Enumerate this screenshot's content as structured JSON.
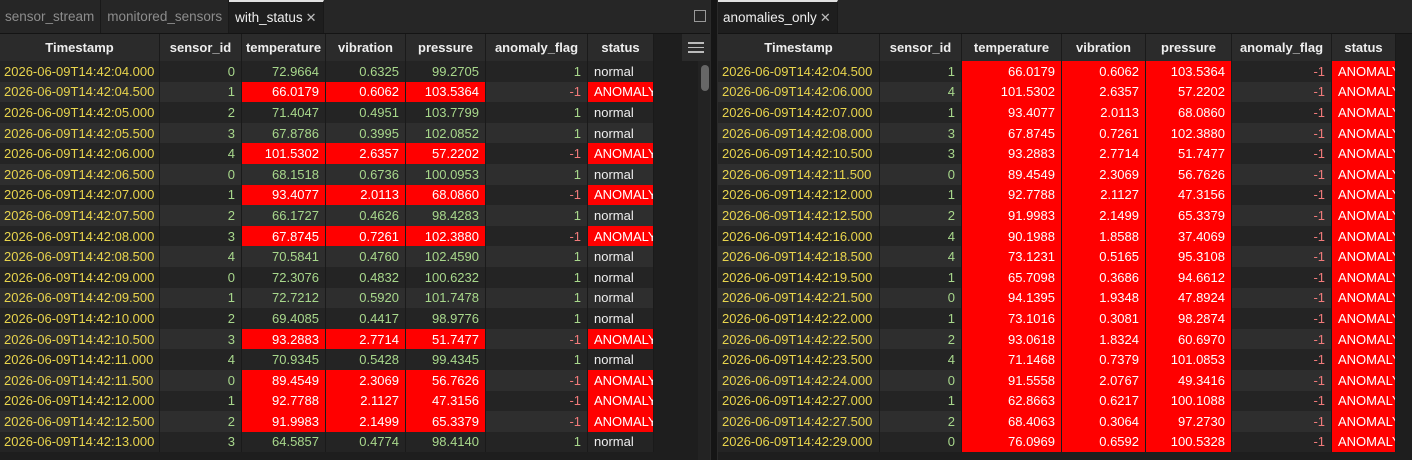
{
  "left": {
    "tabs": [
      {
        "label": "sensor_stream",
        "active": false,
        "closable": false
      },
      {
        "label": "monitored_sensors",
        "active": false,
        "closable": false
      },
      {
        "label": "with_status",
        "active": true,
        "closable": true
      }
    ],
    "columns": [
      "Timestamp",
      "sensor_id",
      "temperature",
      "vibration",
      "pressure",
      "anomaly_flag",
      "status"
    ],
    "rows": [
      [
        "2026-06-09T14:42:04.000",
        "0",
        "72.9664",
        "0.6325",
        "99.2705",
        "1",
        "normal"
      ],
      [
        "2026-06-09T14:42:04.500",
        "1",
        "66.0179",
        "0.6062",
        "103.5364",
        "-1",
        "ANOMALY"
      ],
      [
        "2026-06-09T14:42:05.000",
        "2",
        "71.4047",
        "0.4951",
        "103.7799",
        "1",
        "normal"
      ],
      [
        "2026-06-09T14:42:05.500",
        "3",
        "67.8786",
        "0.3995",
        "102.0852",
        "1",
        "normal"
      ],
      [
        "2026-06-09T14:42:06.000",
        "4",
        "101.5302",
        "2.6357",
        "57.2202",
        "-1",
        "ANOMALY"
      ],
      [
        "2026-06-09T14:42:06.500",
        "0",
        "68.1518",
        "0.6736",
        "100.0953",
        "1",
        "normal"
      ],
      [
        "2026-06-09T14:42:07.000",
        "1",
        "93.4077",
        "2.0113",
        "68.0860",
        "-1",
        "ANOMALY"
      ],
      [
        "2026-06-09T14:42:07.500",
        "2",
        "66.1727",
        "0.4626",
        "98.4283",
        "1",
        "normal"
      ],
      [
        "2026-06-09T14:42:08.000",
        "3",
        "67.8745",
        "0.7261",
        "102.3880",
        "-1",
        "ANOMALY"
      ],
      [
        "2026-06-09T14:42:08.500",
        "4",
        "70.5841",
        "0.4760",
        "102.4590",
        "1",
        "normal"
      ],
      [
        "2026-06-09T14:42:09.000",
        "0",
        "72.3076",
        "0.4832",
        "100.6232",
        "1",
        "normal"
      ],
      [
        "2026-06-09T14:42:09.500",
        "1",
        "72.7212",
        "0.5920",
        "101.7478",
        "1",
        "normal"
      ],
      [
        "2026-06-09T14:42:10.000",
        "2",
        "69.4085",
        "0.4417",
        "98.9776",
        "1",
        "normal"
      ],
      [
        "2026-06-09T14:42:10.500",
        "3",
        "93.2883",
        "2.7714",
        "51.7477",
        "-1",
        "ANOMALY"
      ],
      [
        "2026-06-09T14:42:11.000",
        "4",
        "70.9345",
        "0.5428",
        "99.4345",
        "1",
        "normal"
      ],
      [
        "2026-06-09T14:42:11.500",
        "0",
        "89.4549",
        "2.3069",
        "56.7626",
        "-1",
        "ANOMALY"
      ],
      [
        "2026-06-09T14:42:12.000",
        "1",
        "92.7788",
        "2.1127",
        "47.3156",
        "-1",
        "ANOMALY"
      ],
      [
        "2026-06-09T14:42:12.500",
        "2",
        "91.9983",
        "2.1499",
        "65.3379",
        "-1",
        "ANOMALY"
      ],
      [
        "2026-06-09T14:42:13.000",
        "3",
        "64.5857",
        "0.4774",
        "98.4140",
        "1",
        "normal"
      ]
    ]
  },
  "right": {
    "tabs": [
      {
        "label": "anomalies_only",
        "active": true,
        "closable": true
      }
    ],
    "columns": [
      "Timestamp",
      "sensor_id",
      "temperature",
      "vibration",
      "pressure",
      "anomaly_flag",
      "status"
    ],
    "rows": [
      [
        "2026-06-09T14:42:04.500",
        "1",
        "66.0179",
        "0.6062",
        "103.5364",
        "-1",
        "ANOMALY"
      ],
      [
        "2026-06-09T14:42:06.000",
        "4",
        "101.5302",
        "2.6357",
        "57.2202",
        "-1",
        "ANOMALY"
      ],
      [
        "2026-06-09T14:42:07.000",
        "1",
        "93.4077",
        "2.0113",
        "68.0860",
        "-1",
        "ANOMALY"
      ],
      [
        "2026-06-09T14:42:08.000",
        "3",
        "67.8745",
        "0.7261",
        "102.3880",
        "-1",
        "ANOMALY"
      ],
      [
        "2026-06-09T14:42:10.500",
        "3",
        "93.2883",
        "2.7714",
        "51.7477",
        "-1",
        "ANOMALY"
      ],
      [
        "2026-06-09T14:42:11.500",
        "0",
        "89.4549",
        "2.3069",
        "56.7626",
        "-1",
        "ANOMALY"
      ],
      [
        "2026-06-09T14:42:12.000",
        "1",
        "92.7788",
        "2.1127",
        "47.3156",
        "-1",
        "ANOMALY"
      ],
      [
        "2026-06-09T14:42:12.500",
        "2",
        "91.9983",
        "2.1499",
        "65.3379",
        "-1",
        "ANOMALY"
      ],
      [
        "2026-06-09T14:42:16.000",
        "4",
        "90.1988",
        "1.8588",
        "37.4069",
        "-1",
        "ANOMALY"
      ],
      [
        "2026-06-09T14:42:18.500",
        "4",
        "73.1231",
        "0.5165",
        "95.3108",
        "-1",
        "ANOMALY"
      ],
      [
        "2026-06-09T14:42:19.500",
        "1",
        "65.7098",
        "0.3686",
        "94.6612",
        "-1",
        "ANOMALY"
      ],
      [
        "2026-06-09T14:42:21.500",
        "0",
        "94.1395",
        "1.9348",
        "47.8924",
        "-1",
        "ANOMALY"
      ],
      [
        "2026-06-09T14:42:22.000",
        "1",
        "73.1016",
        "0.3081",
        "98.2874",
        "-1",
        "ANOMALY"
      ],
      [
        "2026-06-09T14:42:22.500",
        "2",
        "93.0618",
        "1.8324",
        "60.6970",
        "-1",
        "ANOMALY"
      ],
      [
        "2026-06-09T14:42:23.500",
        "4",
        "71.1468",
        "0.7379",
        "101.0853",
        "-1",
        "ANOMALY"
      ],
      [
        "2026-06-09T14:42:24.000",
        "0",
        "91.5558",
        "2.0767",
        "49.3416",
        "-1",
        "ANOMALY"
      ],
      [
        "2026-06-09T14:42:27.000",
        "1",
        "62.8663",
        "0.6217",
        "100.1088",
        "-1",
        "ANOMALY"
      ],
      [
        "2026-06-09T14:42:27.500",
        "2",
        "68.4063",
        "0.3064",
        "97.2730",
        "-1",
        "ANOMALY"
      ],
      [
        "2026-06-09T14:42:29.000",
        "0",
        "76.0969",
        "0.6592",
        "100.5328",
        "-1",
        "ANOMALY"
      ]
    ]
  },
  "colors": {
    "anomaly_bg": "#ff0000",
    "timestamp_text": "#e8d44d",
    "number_text": "#a8d88c",
    "negative_flag_text": "#f07a7a"
  },
  "icons": {
    "tab_close": "close-icon",
    "maximize": "maximize-icon",
    "column_menu": "hamburger-menu-icon"
  }
}
